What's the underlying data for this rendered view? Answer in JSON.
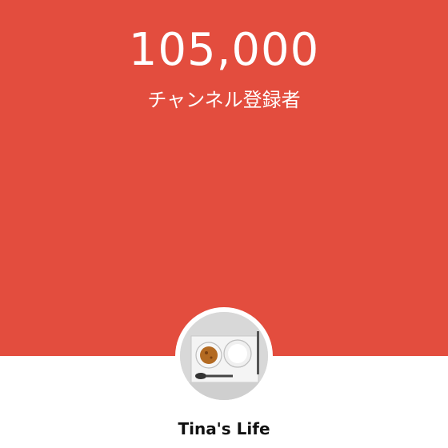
{
  "stats": {
    "subscriber_count": "105,000",
    "subscriber_label": "チャンネル登録者"
  },
  "channel": {
    "name": "Tina's Life",
    "avatar_icon": "food-photo-avatar"
  },
  "colors": {
    "banner": "#e34d3e",
    "text_on_banner": "#ffffff",
    "name_text": "#111111"
  }
}
